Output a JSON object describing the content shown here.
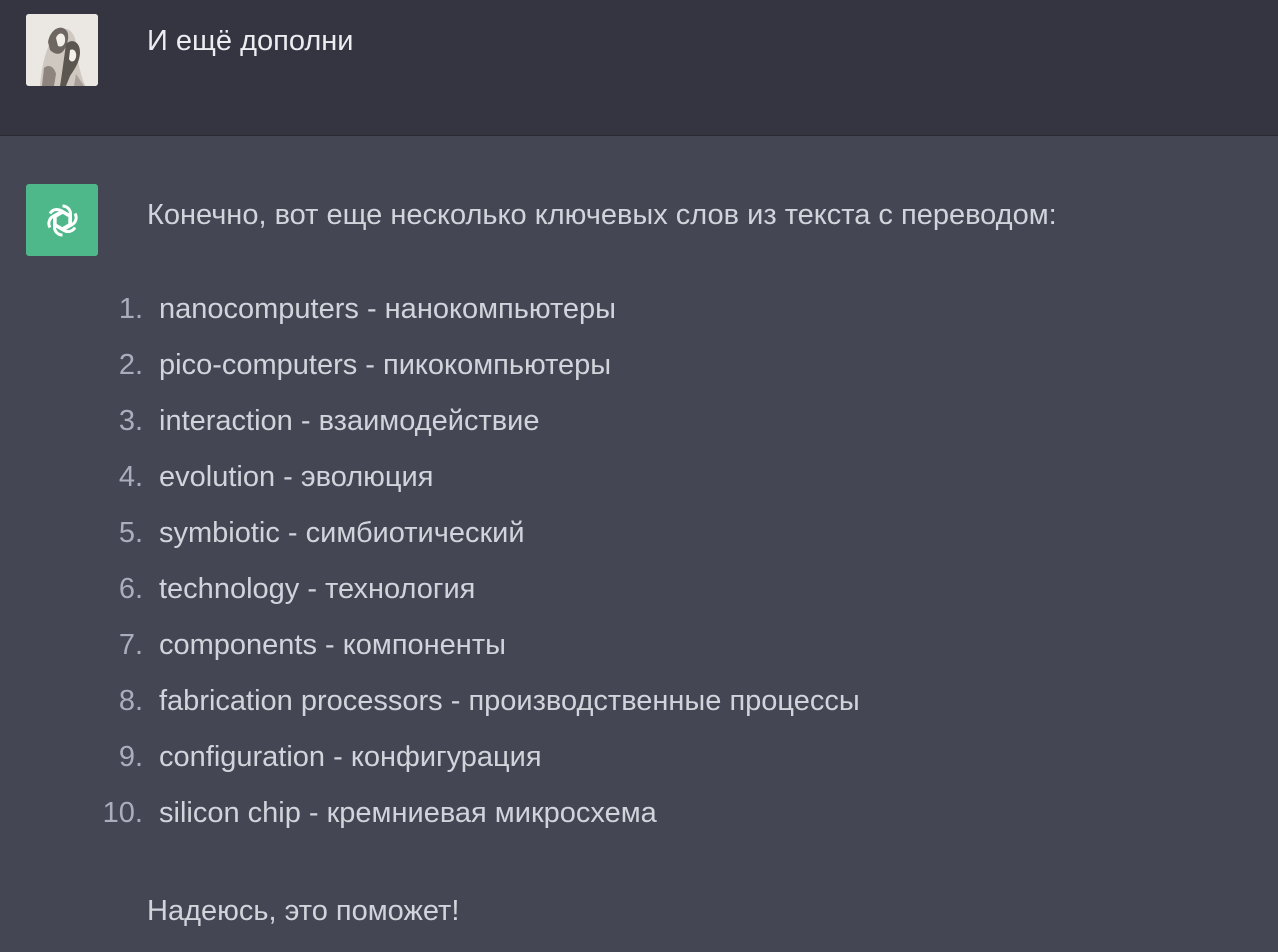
{
  "user_message": {
    "text": "И ещё дополни",
    "avatar": "user-photo-avatar"
  },
  "assistant_message": {
    "avatar_icon": "openai-logo-icon",
    "accent_color": "#4fb88a",
    "intro": "Конечно, вот еще несколько ключевых слов из текста с переводом:",
    "items": [
      {
        "num": "1.",
        "text": "nanocomputers - нанокомпьютеры"
      },
      {
        "num": "2.",
        "text": "pico-computers - пикокомпьютеры"
      },
      {
        "num": "3.",
        "text": "interaction - взаимодействие"
      },
      {
        "num": "4.",
        "text": "evolution - эволюция"
      },
      {
        "num": "5.",
        "text": "symbiotic - симбиотический"
      },
      {
        "num": "6.",
        "text": "technology - технология"
      },
      {
        "num": "7.",
        "text": "components - компоненты"
      },
      {
        "num": "8.",
        "text": "fabrication processors - производственные процессы"
      },
      {
        "num": "9.",
        "text": "configuration - конфигурация"
      },
      {
        "num": "10.",
        "text": "silicon chip - кремниевая микросхема"
      }
    ],
    "outro": "Надеюсь, это поможет!"
  },
  "colors": {
    "user_bg": "#343541",
    "assistant_bg": "#444654",
    "text": "#d1d5db"
  }
}
